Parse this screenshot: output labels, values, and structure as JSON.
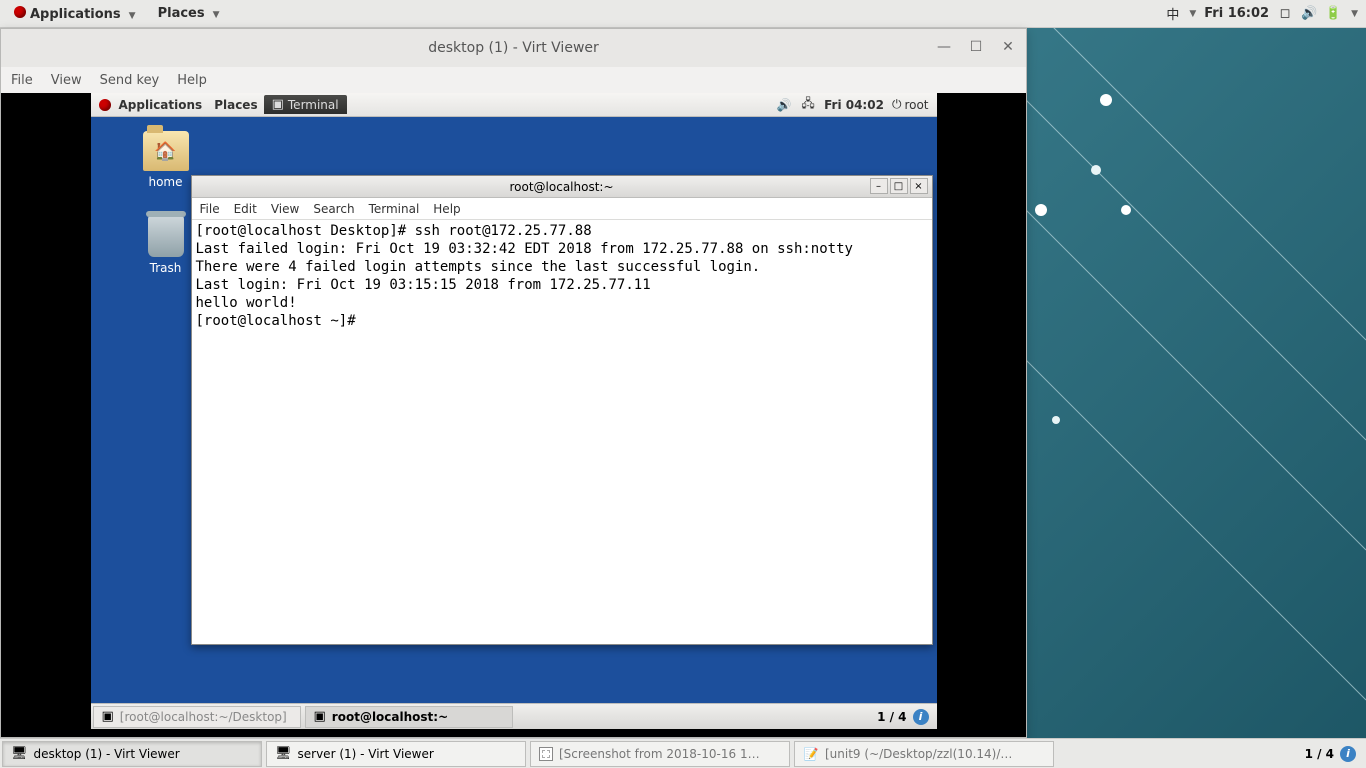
{
  "host": {
    "menu": {
      "applications": "Applications",
      "places": "Places"
    },
    "tray": {
      "ime": "中",
      "clock": "Fri 16:02"
    },
    "taskbar": {
      "tasks": [
        {
          "label": "desktop (1) - Virt Viewer"
        },
        {
          "label": "server (1) - Virt Viewer"
        },
        {
          "label": "[Screenshot from 2018-10-16 1…"
        },
        {
          "label": "[unit9 (~/Desktop/zzl(10.14)/…"
        }
      ],
      "workspace": "1 / 4"
    }
  },
  "virtviewer": {
    "title": "desktop (1) - Virt Viewer",
    "menu": {
      "file": "File",
      "view": "View",
      "sendkey": "Send key",
      "help": "Help"
    }
  },
  "vm": {
    "panel": {
      "applications": "Applications",
      "places": "Places",
      "active_task": "Terminal",
      "clock": "Fri 04:02",
      "user": "root"
    },
    "icons": {
      "home": "home",
      "trash": "Trash"
    },
    "terminal": {
      "title": "root@localhost:~",
      "menu": {
        "file": "File",
        "edit": "Edit",
        "view": "View",
        "search": "Search",
        "terminal": "Terminal",
        "help": "Help"
      },
      "lines": [
        "[root@localhost Desktop]# ssh root@172.25.77.88",
        "Last failed login: Fri Oct 19 03:32:42 EDT 2018 from 172.25.77.88 on ssh:notty",
        "There were 4 failed login attempts since the last successful login.",
        "Last login: Fri Oct 19 03:15:15 2018 from 172.25.77.11",
        "hello world!",
        "[root@localhost ~]# "
      ]
    },
    "bottom": {
      "tasks": [
        {
          "label": "[root@localhost:~/Desktop]"
        },
        {
          "label": "root@localhost:~"
        }
      ],
      "workspace": "1 / 4"
    }
  }
}
